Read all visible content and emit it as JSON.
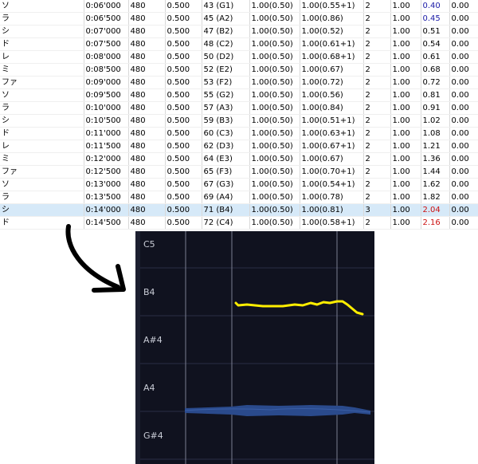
{
  "table": {
    "rows": [
      {
        "note": "ソ",
        "time": "0:06'000",
        "ticks": "480",
        "len": "0.500",
        "pitch": "43 (G1)",
        "vel": "1.00(0.50)",
        "mod": "1.00(0.55+1)",
        "ch": "2",
        "a": "1.00",
        "b": "0.40",
        "b_color": "blue",
        "c": "0.00"
      },
      {
        "note": "ラ",
        "time": "0:06'500",
        "ticks": "480",
        "len": "0.500",
        "pitch": "45 (A2)",
        "vel": "1.00(0.50)",
        "mod": "1.00(0.86)",
        "ch": "2",
        "a": "1.00",
        "b": "0.45",
        "b_color": "blue",
        "c": "0.00"
      },
      {
        "note": "シ",
        "time": "0:07'000",
        "ticks": "480",
        "len": "0.500",
        "pitch": "47 (B2)",
        "vel": "1.00(0.50)",
        "mod": "1.00(0.52)",
        "ch": "2",
        "a": "1.00",
        "b": "0.51",
        "b_color": "",
        "c": "0.00"
      },
      {
        "note": "ド",
        "time": "0:07'500",
        "ticks": "480",
        "len": "0.500",
        "pitch": "48 (C2)",
        "vel": "1.00(0.50)",
        "mod": "1.00(0.61+1)",
        "ch": "2",
        "a": "1.00",
        "b": "0.54",
        "b_color": "",
        "c": "0.00"
      },
      {
        "note": "レ",
        "time": "0:08'000",
        "ticks": "480",
        "len": "0.500",
        "pitch": "50 (D2)",
        "vel": "1.00(0.50)",
        "mod": "1.00(0.68+1)",
        "ch": "2",
        "a": "1.00",
        "b": "0.61",
        "b_color": "",
        "c": "0.00"
      },
      {
        "note": "ミ",
        "time": "0:08'500",
        "ticks": "480",
        "len": "0.500",
        "pitch": "52 (E2)",
        "vel": "1.00(0.50)",
        "mod": "1.00(0.67)",
        "ch": "2",
        "a": "1.00",
        "b": "0.68",
        "b_color": "",
        "c": "0.00"
      },
      {
        "note": "ファ",
        "time": "0:09'000",
        "ticks": "480",
        "len": "0.500",
        "pitch": "53 (F2)",
        "vel": "1.00(0.50)",
        "mod": "1.00(0.72)",
        "ch": "2",
        "a": "1.00",
        "b": "0.72",
        "b_color": "",
        "c": "0.00"
      },
      {
        "note": "ソ",
        "time": "0:09'500",
        "ticks": "480",
        "len": "0.500",
        "pitch": "55 (G2)",
        "vel": "1.00(0.50)",
        "mod": "1.00(0.56)",
        "ch": "2",
        "a": "1.00",
        "b": "0.81",
        "b_color": "",
        "c": "0.00"
      },
      {
        "note": "ラ",
        "time": "0:10'000",
        "ticks": "480",
        "len": "0.500",
        "pitch": "57 (A3)",
        "vel": "1.00(0.50)",
        "mod": "1.00(0.84)",
        "ch": "2",
        "a": "1.00",
        "b": "0.91",
        "b_color": "",
        "c": "0.00"
      },
      {
        "note": "シ",
        "time": "0:10'500",
        "ticks": "480",
        "len": "0.500",
        "pitch": "59 (B3)",
        "vel": "1.00(0.50)",
        "mod": "1.00(0.51+1)",
        "ch": "2",
        "a": "1.00",
        "b": "1.02",
        "b_color": "",
        "c": "0.00"
      },
      {
        "note": "ド",
        "time": "0:11'000",
        "ticks": "480",
        "len": "0.500",
        "pitch": "60 (C3)",
        "vel": "1.00(0.50)",
        "mod": "1.00(0.63+1)",
        "ch": "2",
        "a": "1.00",
        "b": "1.08",
        "b_color": "",
        "c": "0.00"
      },
      {
        "note": "レ",
        "time": "0:11'500",
        "ticks": "480",
        "len": "0.500",
        "pitch": "62 (D3)",
        "vel": "1.00(0.50)",
        "mod": "1.00(0.67+1)",
        "ch": "2",
        "a": "1.00",
        "b": "1.21",
        "b_color": "",
        "c": "0.00"
      },
      {
        "note": "ミ",
        "time": "0:12'000",
        "ticks": "480",
        "len": "0.500",
        "pitch": "64 (E3)",
        "vel": "1.00(0.50)",
        "mod": "1.00(0.67)",
        "ch": "2",
        "a": "1.00",
        "b": "1.36",
        "b_color": "",
        "c": "0.00"
      },
      {
        "note": "ファ",
        "time": "0:12'500",
        "ticks": "480",
        "len": "0.500",
        "pitch": "65 (F3)",
        "vel": "1.00(0.50)",
        "mod": "1.00(0.70+1)",
        "ch": "2",
        "a": "1.00",
        "b": "1.44",
        "b_color": "",
        "c": "0.00"
      },
      {
        "note": "ソ",
        "time": "0:13'000",
        "ticks": "480",
        "len": "0.500",
        "pitch": "67 (G3)",
        "vel": "1.00(0.50)",
        "mod": "1.00(0.54+1)",
        "ch": "2",
        "a": "1.00",
        "b": "1.62",
        "b_color": "",
        "c": "0.00"
      },
      {
        "note": "ラ",
        "time": "0:13'500",
        "ticks": "480",
        "len": "0.500",
        "pitch": "69 (A4)",
        "vel": "1.00(0.50)",
        "mod": "1.00(0.78)",
        "ch": "2",
        "a": "1.00",
        "b": "1.82",
        "b_color": "",
        "c": "0.00"
      },
      {
        "note": "シ",
        "time": "0:14'000",
        "ticks": "480",
        "len": "0.500",
        "pitch": "71 (B4)",
        "vel": "1.00(0.50)",
        "mod": "1.00(0.81)",
        "ch": "3",
        "a": "1.00",
        "b": "2.04",
        "b_color": "red",
        "c": "0.00",
        "selected": true
      },
      {
        "note": "ド",
        "time": "0:14'500",
        "ticks": "480",
        "len": "0.500",
        "pitch": "72 (C4)",
        "vel": "1.00(0.50)",
        "mod": "1.00(0.58+1)",
        "ch": "2",
        "a": "1.00",
        "b": "2.16",
        "b_color": "red",
        "c": "0.00"
      }
    ]
  },
  "pitch_view": {
    "labels": [
      "C5",
      "B4",
      "A#4",
      "A4",
      "G#4"
    ],
    "background": "#10121f",
    "pitch_curve_color": "#ffee00",
    "waveform_color": "#2a4a8c"
  },
  "arrow": {
    "icon": "hand-drawn-curved-arrow-icon",
    "color": "#000000"
  }
}
